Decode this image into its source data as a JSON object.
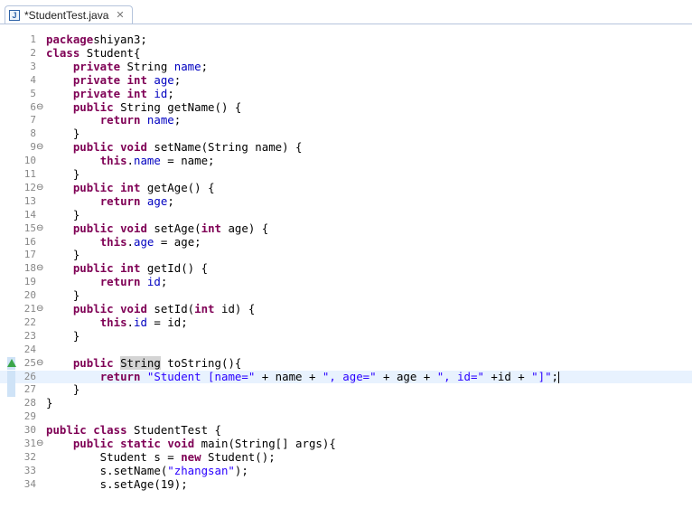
{
  "tab": {
    "title": "*StudentTest.java",
    "close_glyph": "✕",
    "icon_letter": "J",
    "icon": "java-file-icon"
  },
  "fold_glyph": "⊖",
  "lines": [
    {
      "num": "1",
      "tokens": [
        [
          "kw",
          "package"
        ],
        [
          "",
          "shiyan3;"
        ]
      ]
    },
    {
      "num": "2",
      "tokens": [
        [
          "kw",
          "class"
        ],
        [
          "",
          " Student{"
        ]
      ]
    },
    {
      "num": "3",
      "tokens": [
        [
          "",
          "    "
        ],
        [
          "kw",
          "private"
        ],
        [
          "",
          " String "
        ],
        [
          "fld",
          "name"
        ],
        [
          "",
          ";"
        ]
      ]
    },
    {
      "num": "4",
      "tokens": [
        [
          "",
          "    "
        ],
        [
          "kw",
          "private"
        ],
        [
          "",
          " "
        ],
        [
          "kw",
          "int"
        ],
        [
          "",
          " "
        ],
        [
          "fld",
          "age"
        ],
        [
          "",
          ";"
        ]
      ]
    },
    {
      "num": "5",
      "tokens": [
        [
          "",
          "    "
        ],
        [
          "kw",
          "private"
        ],
        [
          "",
          " "
        ],
        [
          "kw",
          "int"
        ],
        [
          "",
          " "
        ],
        [
          "fld",
          "id"
        ],
        [
          "",
          ";"
        ]
      ]
    },
    {
      "num": "6",
      "fold": true,
      "tokens": [
        [
          "",
          "    "
        ],
        [
          "kw",
          "public"
        ],
        [
          "",
          " String getName() {"
        ]
      ]
    },
    {
      "num": "7",
      "tokens": [
        [
          "",
          "        "
        ],
        [
          "kw",
          "return"
        ],
        [
          "",
          " "
        ],
        [
          "fld",
          "name"
        ],
        [
          "",
          ";"
        ]
      ]
    },
    {
      "num": "8",
      "tokens": [
        [
          "",
          "    }"
        ]
      ]
    },
    {
      "num": "9",
      "fold": true,
      "tokens": [
        [
          "",
          "    "
        ],
        [
          "kw",
          "public"
        ],
        [
          "",
          " "
        ],
        [
          "kw",
          "void"
        ],
        [
          "",
          " setName(String name) {"
        ]
      ]
    },
    {
      "num": "10",
      "tokens": [
        [
          "",
          "        "
        ],
        [
          "kw",
          "this"
        ],
        [
          "",
          "."
        ],
        [
          "fld",
          "name"
        ],
        [
          "",
          " = name;"
        ]
      ]
    },
    {
      "num": "11",
      "tokens": [
        [
          "",
          "    }"
        ]
      ]
    },
    {
      "num": "12",
      "fold": true,
      "tokens": [
        [
          "",
          "    "
        ],
        [
          "kw",
          "public"
        ],
        [
          "",
          " "
        ],
        [
          "kw",
          "int"
        ],
        [
          "",
          " getAge() {"
        ]
      ]
    },
    {
      "num": "13",
      "tokens": [
        [
          "",
          "        "
        ],
        [
          "kw",
          "return"
        ],
        [
          "",
          " "
        ],
        [
          "fld",
          "age"
        ],
        [
          "",
          ";"
        ]
      ]
    },
    {
      "num": "14",
      "tokens": [
        [
          "",
          "    }"
        ]
      ]
    },
    {
      "num": "15",
      "fold": true,
      "tokens": [
        [
          "",
          "    "
        ],
        [
          "kw",
          "public"
        ],
        [
          "",
          " "
        ],
        [
          "kw",
          "void"
        ],
        [
          "",
          " setAge("
        ],
        [
          "kw",
          "int"
        ],
        [
          "",
          " age) {"
        ]
      ]
    },
    {
      "num": "16",
      "tokens": [
        [
          "",
          "        "
        ],
        [
          "kw",
          "this"
        ],
        [
          "",
          "."
        ],
        [
          "fld",
          "age"
        ],
        [
          "",
          " = age;"
        ]
      ]
    },
    {
      "num": "17",
      "tokens": [
        [
          "",
          "    }"
        ]
      ]
    },
    {
      "num": "18",
      "fold": true,
      "tokens": [
        [
          "",
          "    "
        ],
        [
          "kw",
          "public"
        ],
        [
          "",
          " "
        ],
        [
          "kw",
          "int"
        ],
        [
          "",
          " getId() {"
        ]
      ]
    },
    {
      "num": "19",
      "tokens": [
        [
          "",
          "        "
        ],
        [
          "kw",
          "return"
        ],
        [
          "",
          " "
        ],
        [
          "fld",
          "id"
        ],
        [
          "",
          ";"
        ]
      ]
    },
    {
      "num": "20",
      "tokens": [
        [
          "",
          "    }"
        ]
      ]
    },
    {
      "num": "21",
      "fold": true,
      "tokens": [
        [
          "",
          "    "
        ],
        [
          "kw",
          "public"
        ],
        [
          "",
          " "
        ],
        [
          "kw",
          "void"
        ],
        [
          "",
          " setId("
        ],
        [
          "kw",
          "int"
        ],
        [
          "",
          " id) {"
        ]
      ]
    },
    {
      "num": "22",
      "tokens": [
        [
          "",
          "        "
        ],
        [
          "kw",
          "this"
        ],
        [
          "",
          "."
        ],
        [
          "fld",
          "id"
        ],
        [
          "",
          " = id;"
        ]
      ]
    },
    {
      "num": "23",
      "tokens": [
        [
          "",
          "    }"
        ]
      ]
    },
    {
      "num": "24",
      "tokens": []
    },
    {
      "num": "25",
      "fold": true,
      "warn": true,
      "tokens": [
        [
          "",
          "    "
        ],
        [
          "kw",
          "public"
        ],
        [
          "",
          " "
        ],
        [
          "occ",
          "String"
        ],
        [
          "",
          " toString(){"
        ]
      ]
    },
    {
      "num": "26",
      "highlight": true,
      "caret": true,
      "tokens": [
        [
          "",
          "        "
        ],
        [
          "kw",
          "return"
        ],
        [
          "",
          " "
        ],
        [
          "str",
          "\"Student [name=\""
        ],
        [
          "",
          " + name + "
        ],
        [
          "str",
          "\", age=\""
        ],
        [
          "",
          " + age + "
        ],
        [
          "str",
          "\", id=\""
        ],
        [
          "",
          " +id + "
        ],
        [
          "str",
          "\"]\""
        ],
        [
          "",
          ";"
        ]
      ]
    },
    {
      "num": "27",
      "tokens": [
        [
          "",
          "    }"
        ]
      ]
    },
    {
      "num": "28",
      "tokens": [
        [
          "",
          "}"
        ]
      ]
    },
    {
      "num": "29",
      "tokens": []
    },
    {
      "num": "30",
      "tokens": [
        [
          "kw",
          "public"
        ],
        [
          "",
          " "
        ],
        [
          "kw",
          "class"
        ],
        [
          "",
          " StudentTest {"
        ]
      ]
    },
    {
      "num": "31",
      "fold": true,
      "tokens": [
        [
          "",
          "    "
        ],
        [
          "kw",
          "public"
        ],
        [
          "",
          " "
        ],
        [
          "kw",
          "static"
        ],
        [
          "",
          " "
        ],
        [
          "kw",
          "void"
        ],
        [
          "",
          " main(String[] args){"
        ]
      ]
    },
    {
      "num": "32",
      "tokens": [
        [
          "",
          "        Student s = "
        ],
        [
          "kw",
          "new"
        ],
        [
          "",
          " Student();"
        ]
      ]
    },
    {
      "num": "33",
      "tokens": [
        [
          "",
          "        s.setName("
        ],
        [
          "str",
          "\"zhangsan\""
        ],
        [
          "",
          ");"
        ]
      ]
    },
    {
      "num": "34",
      "tokens": [
        [
          "",
          "        s.setAge(19);"
        ]
      ]
    }
  ]
}
